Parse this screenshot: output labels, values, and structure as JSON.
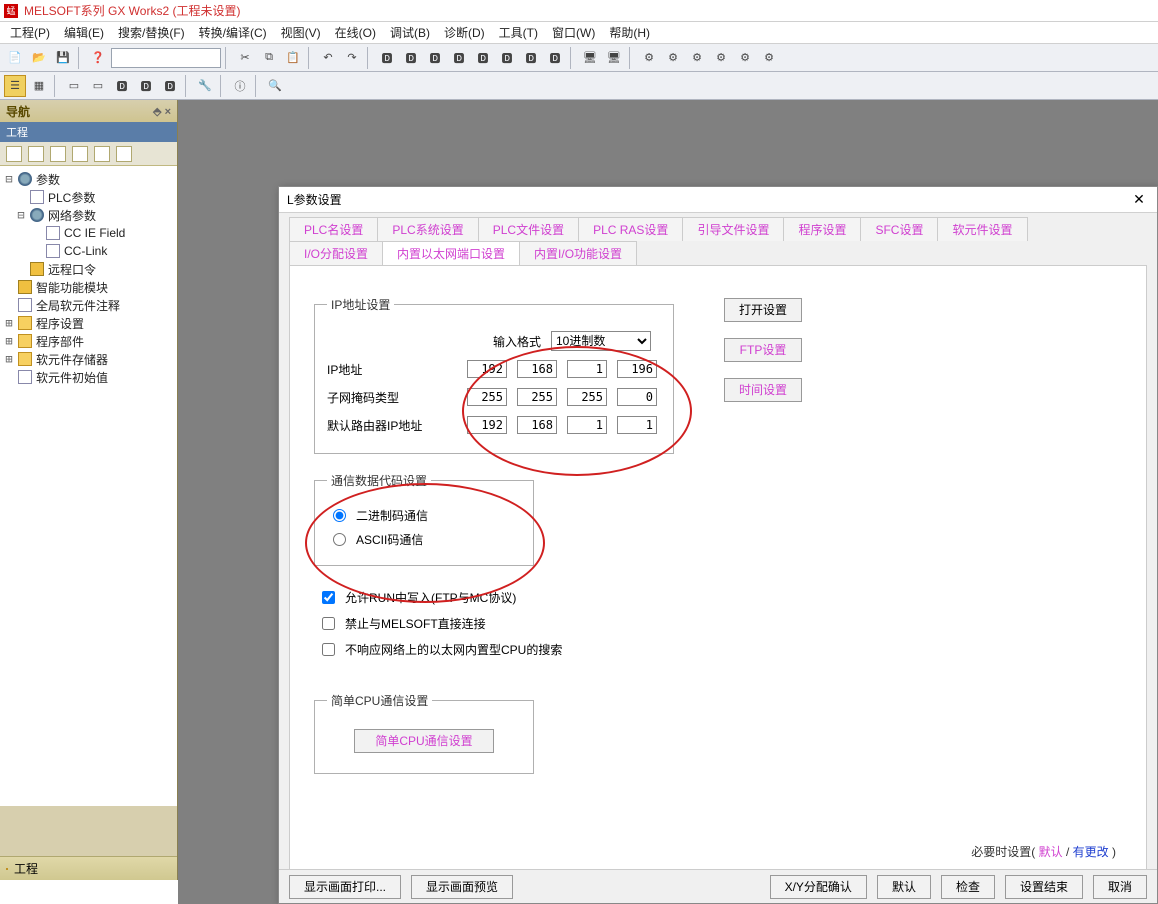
{
  "titlebar": {
    "text": "MELSOFT系列 GX Works2 (工程未设置)"
  },
  "menu": [
    "工程(P)",
    "编辑(E)",
    "搜索/替换(F)",
    "转换/编译(C)",
    "视图(V)",
    "在线(O)",
    "调试(B)",
    "诊断(D)",
    "工具(T)",
    "窗口(W)",
    "帮助(H)"
  ],
  "nav": {
    "title": "导航",
    "pin": "⬘ ×",
    "sub": "工程",
    "tree": [
      {
        "exp": "⊟",
        "ico": "ico-gear",
        "label": "参数",
        "ind": ""
      },
      {
        "exp": "",
        "ico": "ico-doc",
        "label": "PLC参数",
        "ind": "ind1"
      },
      {
        "exp": "⊟",
        "ico": "ico-gear",
        "label": "网络参数",
        "ind": "ind1"
      },
      {
        "exp": "",
        "ico": "ico-doc",
        "label": "CC IE Field",
        "ind": "ind2"
      },
      {
        "exp": "",
        "ico": "ico-doc",
        "label": "CC-Link",
        "ind": "ind2"
      },
      {
        "exp": "",
        "ico": "ico-mod",
        "label": "远程口令",
        "ind": "ind1"
      },
      {
        "exp": "",
        "ico": "ico-mod",
        "label": "智能功能模块",
        "ind": ""
      },
      {
        "exp": "",
        "ico": "ico-doc",
        "label": "全局软元件注释",
        "ind": ""
      },
      {
        "exp": "⊞",
        "ico": "ico-folder",
        "label": "程序设置",
        "ind": ""
      },
      {
        "exp": "⊞",
        "ico": "ico-folder",
        "label": "程序部件",
        "ind": ""
      },
      {
        "exp": "⊞",
        "ico": "ico-folder",
        "label": "软元件存储器",
        "ind": ""
      },
      {
        "exp": "",
        "ico": "ico-doc",
        "label": "软元件初始值",
        "ind": ""
      }
    ],
    "footer_label": "工程"
  },
  "dialog": {
    "title": "L参数设置",
    "tabs_row1": [
      "PLC名设置",
      "PLC系统设置",
      "PLC文件设置",
      "PLC RAS设置",
      "引导文件设置",
      "程序设置",
      "SFC设置",
      "软元件设置"
    ],
    "tabs_row2": [
      "I/O分配设置",
      "内置以太网端口设置",
      "内置I/O功能设置"
    ],
    "active_tab": "内置以太网端口设置",
    "ip_group": {
      "legend": "IP地址设置",
      "format_label": "输入格式",
      "format_value": "10进制数",
      "ip_label": "IP地址",
      "ip": [
        "192",
        "168",
        "1",
        "196"
      ],
      "mask_label": "子网掩码类型",
      "mask": [
        "255",
        "255",
        "255",
        "0"
      ],
      "gw_label": "默认路由器IP地址",
      "gw": [
        "192",
        "168",
        "1",
        "1"
      ]
    },
    "side_buttons": {
      "open": "打开设置",
      "ftp": "FTP设置",
      "time": "时间设置"
    },
    "code_group": {
      "legend": "通信数据代码设置",
      "opt_binary": "二进制码通信",
      "opt_ascii": "ASCII码通信"
    },
    "chk_run": "允许RUN中写入(FTP与MC协议)",
    "chk_melsoft": "禁止与MELSOFT直接连接",
    "chk_search": "不响应网络上的以太网内置型CPU的搜索",
    "cpu_group": {
      "legend": "简单CPU通信设置",
      "btn": "简单CPU通信设置"
    },
    "note_prefix": "必要时设置(",
    "note_default": "默认",
    "note_sep": " / ",
    "note_changed": "有更改",
    "note_suffix": " )",
    "footer": {
      "print": "显示画面打印...",
      "preview": "显示画面预览",
      "xy": "X/Y分配确认",
      "default": "默认",
      "check": "检查",
      "end": "设置结束",
      "cancel": "取消"
    }
  }
}
